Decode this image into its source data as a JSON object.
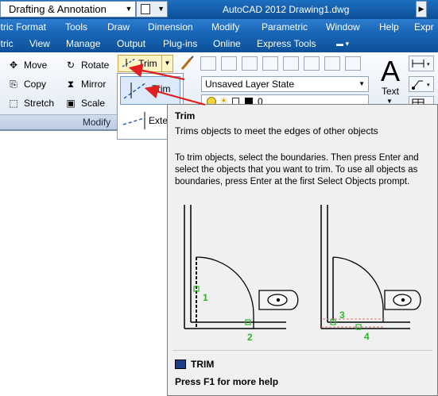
{
  "titlebar": {
    "workspace": "Drafting & Annotation",
    "app_title": "AutoCAD 2012    Drawing1.dwg"
  },
  "menubar": {
    "items": [
      "etric",
      "Format",
      "Tools",
      "Draw",
      "Dimension",
      "Modify",
      "Parametric",
      "Window",
      "Help",
      "Expr"
    ]
  },
  "ribbon_tabs": {
    "items": [
      "etric",
      "View",
      "Manage",
      "Output",
      "Plug-ins",
      "Online",
      "Express Tools"
    ]
  },
  "modify_panel": {
    "label": "Modify",
    "move": "Move",
    "copy": "Copy",
    "stretch": "Stretch",
    "rotate": "Rotate",
    "mirror": "Mirror",
    "scale": "Scale",
    "trim": "Trim"
  },
  "trim_dropdown": {
    "trim": "Trim",
    "extend": "Exten"
  },
  "layers_panel": {
    "layer_state": "Unsaved Layer State",
    "current_layer": "0"
  },
  "annotation_panel": {
    "text_icon": "A",
    "text_label": "Text"
  },
  "tooltip": {
    "title": "Trim",
    "description": "Trims objects to meet the edges of other objects",
    "body": "To trim objects, select the boundaries. Then press Enter and select the objects that you want to trim. To use all objects as boundaries, press Enter at the first Select Objects prompt.",
    "command": "TRIM",
    "help": "Press F1 for more help",
    "figure_labels": [
      "1",
      "2",
      "3",
      "4"
    ]
  },
  "colors": {
    "title_bar": "#0d4f98",
    "highlight": "#fff4c4",
    "annotation_arrow": "#e02020",
    "figure_label": "#2db52d"
  }
}
